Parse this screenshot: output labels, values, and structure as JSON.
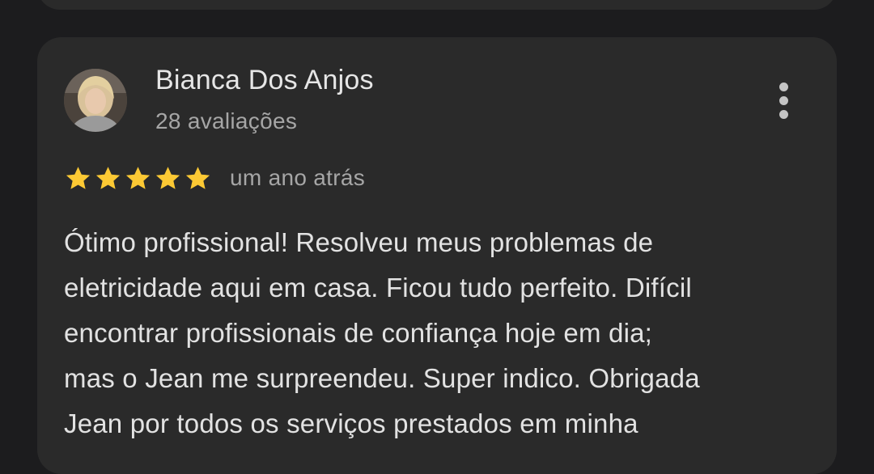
{
  "review": {
    "author_name": "Bianca Dos Anjos",
    "review_count": "28 avaliações",
    "rating": 5,
    "max_rating": 5,
    "time_ago": "um ano atrás",
    "text_lines": [
      "Ótimo profissional! Resolveu meus problemas de",
      "eletricidade aqui em casa. Ficou tudo perfeito. Difícil",
      "encontrar profissionais de confiança hoje em dia;",
      "mas o Jean me surpreendeu. Super indico. Obrigada",
      "Jean por todos os serviços prestados em minha"
    ]
  },
  "icons": {
    "more": "more-vert-icon",
    "star": "star-icon"
  },
  "colors": {
    "background": "#1c1c1e",
    "card": "#2a2a2a",
    "star": "#fcc934",
    "primary_text": "#e6e6e6",
    "secondary_text": "#a6a6a6"
  }
}
